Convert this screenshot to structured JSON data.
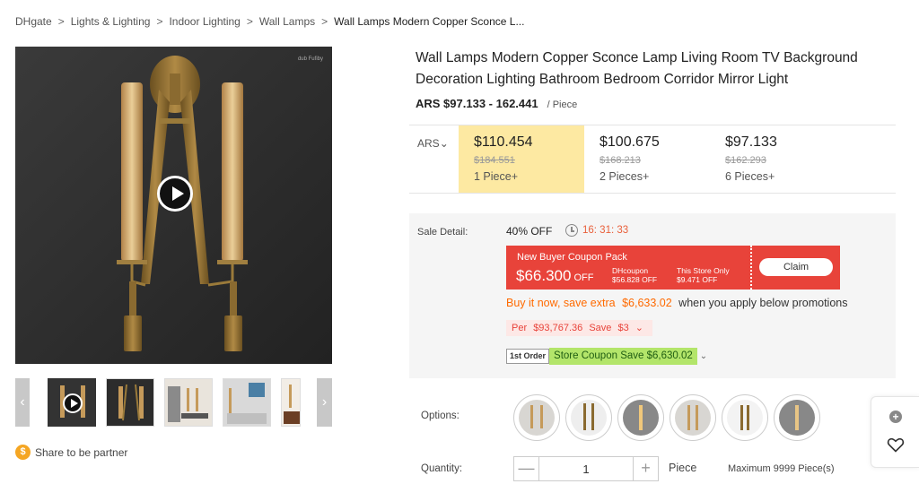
{
  "breadcrumb": {
    "items": [
      "DHgate",
      "Lights & Lighting",
      "Indoor Lighting",
      "Wall Lamps"
    ],
    "current": "Wall Lamps Modern Copper Sconce L...",
    "separator": ">"
  },
  "gallery": {
    "watermark": "dub Fufiby",
    "thumb_prev": "‹",
    "thumb_next": "›"
  },
  "share": {
    "icon": "dollar-coin-icon",
    "coin_symbol": "$",
    "label": "Share to be partner"
  },
  "product": {
    "title": "Wall Lamps Modern Copper Sconce Lamp Living Room TV Background Decoration Lighting Bathroom Bedroom Corridor Mirror Light",
    "price_range": "ARS $97.133 - 162.441",
    "price_unit": "/ Piece"
  },
  "pricing": {
    "currency": "ARS",
    "tiers": [
      {
        "price": "$110.454",
        "original": "$184.551",
        "quantity": "1 Piece+",
        "active": true
      },
      {
        "price": "$100.675",
        "original": "$168.213",
        "quantity": "2 Pieces+",
        "active": false
      },
      {
        "price": "$97.133",
        "original": "$162.293",
        "quantity": "6 Pieces+",
        "active": false
      }
    ]
  },
  "sale": {
    "label": "Sale Detail:",
    "discount": "40% OFF",
    "countdown": "16: 31: 33"
  },
  "coupon": {
    "title": "New Buyer Coupon Pack",
    "amount": "$66.300",
    "amount_suffix": "OFF",
    "dh_label": "DHcoupon",
    "dh_value": "$56.828 OFF",
    "store_label": "This Store Only",
    "store_value": "$9.471 OFF",
    "claim_label": "Claim"
  },
  "promotion": {
    "prefix": "Buy it now, save extra",
    "amount": "$6,633.02",
    "suffix": "when you apply below promotions",
    "per_label": "Per",
    "per_amount": "$93,767.36",
    "save_text": "Save",
    "save_amount": "$3",
    "first_order_tag": "1st Order",
    "store_coupon": "Store Coupon Save $6,630.02"
  },
  "options": {
    "label": "Options:",
    "count": 6
  },
  "quantity": {
    "label": "Quantity:",
    "value": "1",
    "unit": "Piece",
    "maximum": "Maximum 9999 Piece(s)",
    "minus": "—",
    "plus": "+"
  },
  "float_panel": {
    "icons": [
      "plus-circle-icon",
      "heart-icon"
    ]
  },
  "colors": {
    "active_tier_bg": "#fde9a2",
    "coupon_red": "#e8433a",
    "promo_orange": "#ff6a00",
    "store_coupon_green": "#b3e56a",
    "timer_orange": "#e9603b"
  }
}
